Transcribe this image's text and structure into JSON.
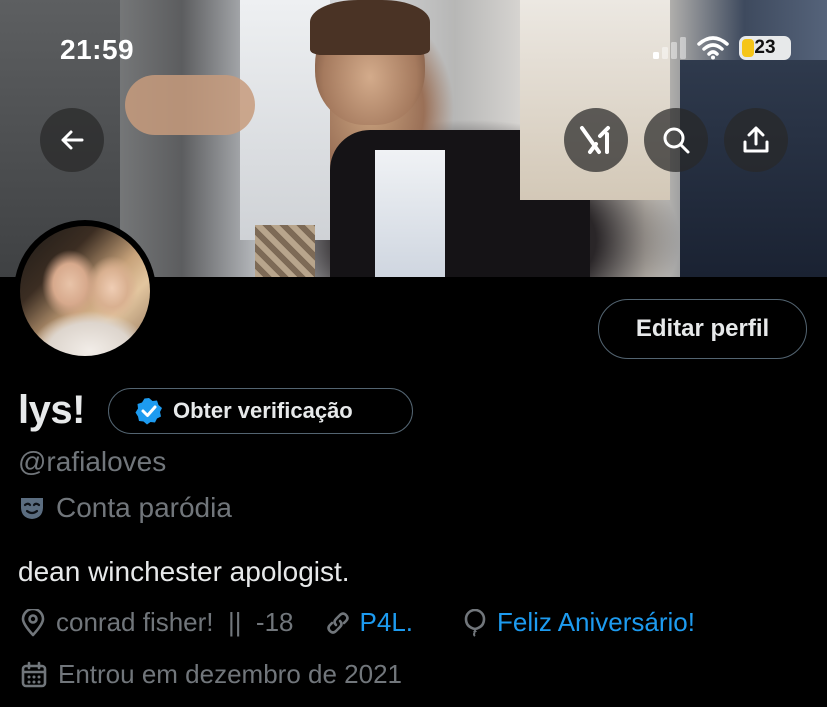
{
  "status_bar": {
    "time": "21:59",
    "battery": "23"
  },
  "header": {
    "back_icon": "arrow-left-icon",
    "grok_icon": "grok-icon",
    "search_icon": "search-icon",
    "share_icon": "share-icon"
  },
  "profile": {
    "edit_label": "Editar perfil",
    "name": "lys!",
    "verify_label": "Obter verificação",
    "handle": "@rafialoves",
    "parody_label": "Conta paródia",
    "bio": "dean winchester apologist.",
    "location": "conrad fisher!  ||  -18",
    "website": "P4L.",
    "birthday": "Feliz Aniversário!",
    "joined": "Entrou em dezembro de 2021"
  },
  "colors": {
    "background": "#000000",
    "text": "#e7e9ea",
    "muted": "#71767b",
    "link": "#1d9bf0",
    "border": "#536471"
  }
}
